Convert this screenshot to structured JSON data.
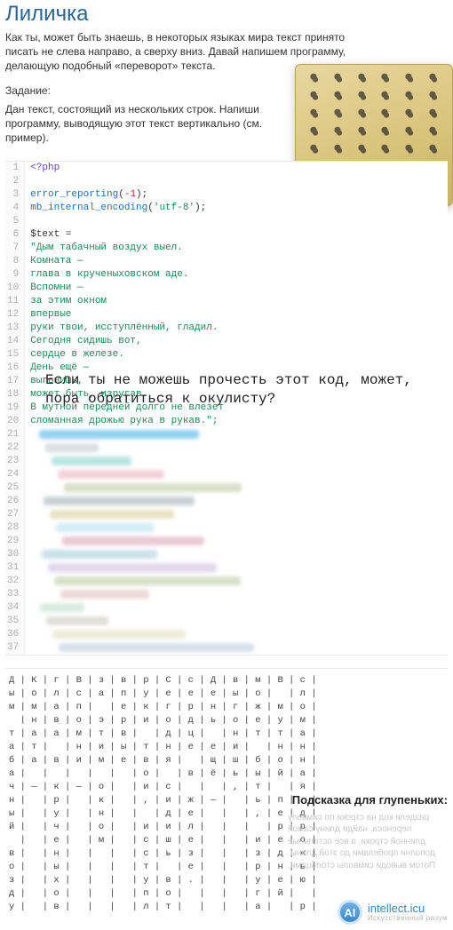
{
  "title": "Лиличка",
  "intro": "Как ты, может быть знаешь, в некоторых языках мира текст принято писать не слева направо, а сверху вниз. Давай напишем программу, делающую подобный «переворот» текста.",
  "task_label": "Задание:",
  "task_body": "Дан текст, состоящий из нескольких строк. Напиши программу, выводящую этот текст вертикально (см. пример).",
  "code": {
    "lines": [
      {
        "n": 1,
        "tokens": [
          {
            "t": "<?php",
            "cls": "c-kw"
          }
        ]
      },
      {
        "n": 2,
        "tokens": []
      },
      {
        "n": 3,
        "tokens": [
          {
            "t": "error_reporting",
            "cls": "c-fn"
          },
          {
            "t": "(",
            "cls": ""
          },
          {
            "t": "-1",
            "cls": "c-num"
          },
          {
            "t": ");",
            "cls": ""
          }
        ]
      },
      {
        "n": 4,
        "tokens": [
          {
            "t": "mb_internal_encoding",
            "cls": "c-fn"
          },
          {
            "t": "(",
            "cls": ""
          },
          {
            "t": "'utf-8'",
            "cls": "c-str"
          },
          {
            "t": ");",
            "cls": ""
          }
        ]
      },
      {
        "n": 5,
        "tokens": []
      },
      {
        "n": 6,
        "tokens": [
          {
            "t": "$text",
            "cls": ""
          },
          {
            "t": " = ",
            "cls": ""
          }
        ]
      },
      {
        "n": 7,
        "tokens": [
          {
            "t": "\"Дым табачный воздух выел.",
            "cls": "c-str"
          }
        ]
      },
      {
        "n": 8,
        "tokens": [
          {
            "t": "Комната —",
            "cls": "c-str"
          }
        ]
      },
      {
        "n": 9,
        "tokens": [
          {
            "t": "глава в крученыховском аде.",
            "cls": "c-str"
          }
        ]
      },
      {
        "n": 10,
        "tokens": [
          {
            "t": "Вспомни —",
            "cls": "c-str"
          }
        ]
      },
      {
        "n": 11,
        "tokens": [
          {
            "t": "за этим окном",
            "cls": "c-str"
          }
        ]
      },
      {
        "n": 12,
        "tokens": [
          {
            "t": "впервые",
            "cls": "c-str"
          }
        ]
      },
      {
        "n": 13,
        "tokens": [
          {
            "t": "руки твои, исступлённый, гладил.",
            "cls": "c-str"
          }
        ]
      },
      {
        "n": 14,
        "tokens": [
          {
            "t": "Сегодня сидишь вот,",
            "cls": "c-str"
          }
        ]
      },
      {
        "n": 15,
        "tokens": [
          {
            "t": "сердце в железе.",
            "cls": "c-str"
          }
        ]
      },
      {
        "n": 16,
        "tokens": [
          {
            "t": "День ещё —",
            "cls": "c-str"
          }
        ]
      },
      {
        "n": 17,
        "tokens": [
          {
            "t": "выгонишь,",
            "cls": "c-str"
          }
        ]
      },
      {
        "n": 18,
        "tokens": [
          {
            "t": "может быть, изругав.",
            "cls": "c-str"
          }
        ]
      },
      {
        "n": 19,
        "tokens": [
          {
            "t": "В мутной передней долго не влезет",
            "cls": "c-str"
          }
        ]
      },
      {
        "n": 20,
        "tokens": [
          {
            "t": "сломанная дрожью рука в рукав.\";",
            "cls": "c-str"
          }
        ]
      }
    ],
    "blurred_line_numbers": [
      21,
      22,
      23,
      24,
      25,
      26,
      27,
      28,
      29,
      30,
      31,
      32,
      33,
      34,
      35,
      36,
      37
    ],
    "blur_palette": [
      "#6ec2f0",
      "#d0d4d6",
      "#9fded7",
      "#f0c2d0",
      "#cfd5b8",
      "#b9c0c7",
      "#e3d9b0",
      "#c2e7f3",
      "#e3b7c4",
      "#b7d8e3",
      "#d6cbe6",
      "#cbd6b7",
      "#e6cbcb",
      "#cbe6d6",
      "#d6d6cb",
      "#e6e6cb",
      "#cbd6e6"
    ],
    "blur_widths": [
      180,
      60,
      90,
      120,
      200,
      170,
      140,
      110,
      160,
      130,
      190,
      210,
      100,
      50,
      70,
      150,
      220
    ]
  },
  "overlay_message": "Если ты не можешь прочесть этот код, может, пора обратиться к окулисту?",
  "vertical_table_rows": [
    "Д | К | г | В | з | в | р | С | с | Д | в | м | В | с |",
    "ы | о | л | с | а | п | у | е | е | е | ы | о |   | л |",
    "м | м | а | п |   | е | к | г | р | н | г | ж | м | о |",
    "  | н | в | о | э | р | и | о | д | ь | о | е | у | м |",
    "т | а | а | м | т | в |   | д | ц |   | н | т | т | а |",
    "а | т |   | н | и | ы | т | н | е | е | и |   | н | н |",
    "б | а | в | и | м | е | в | я |   | щ | ш | б | о | н |",
    "а |   |   |   |   |   | о |   | в | ё | ь | ы | й | а |",
    "ч | — | к | — | о |   | и | с |   |   | , | т |   | я |",
    "н |   | р |   | к |   | , | и | ж | — |   | ь | п |   |",
    "ы |   | у |   | н |   |   | д | е |   |   | , | е | д |",
    "й |   | ч |   | о |   | и | и | л |   |   |   | р | р |",
    "  |   | е |   | м |   | с | ш | е |   |   | и | е | о |",
    "в |   | н |   |   |   | с | ь | з |   |   | з | д | ж |",
    "о |   | ы |   |   |   | т |   | е |   |   | р | н | ь |",
    "з |   | х |   |   |   | у | в | . |   |   | у | е | ю |",
    "д |   | о |   |   |   | п | о |   |   |   | г | й |   |",
    "у |   | в |   |   |   | л | т |   |   |   | а |   | р |"
  ],
  "hint": {
    "title": "Подсказка для глупеньких:",
    "body_mirrored": "раздели код на строки по символу переноса, найди длину самой длинной строки, а все остальные дополни пробелами до этой длины. Потом выводи символы столбцами."
  },
  "logo": {
    "badge": "AI",
    "line1": "intellect.icu",
    "line2": "Искусственный разум"
  }
}
